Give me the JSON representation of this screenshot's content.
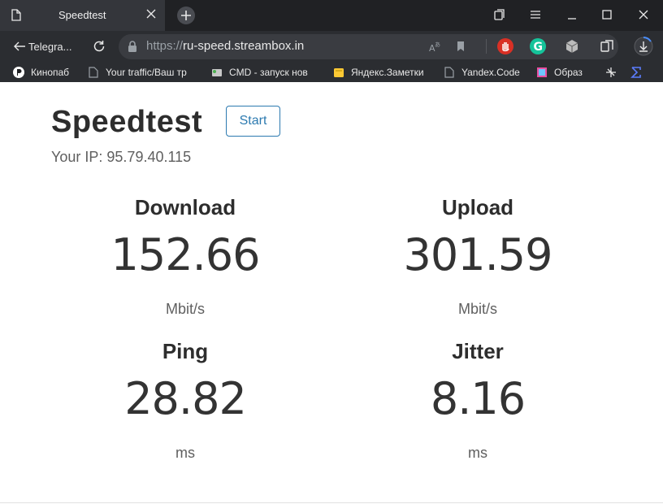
{
  "browser": {
    "tab_title": "Speedtest",
    "back_label": "Telegra...",
    "url_protocol": "https://",
    "url_host": "ru-speed.streambox.in",
    "bookmarks": [
      {
        "label": "Кинопаб",
        "icon": "kinopub-icon"
      },
      {
        "label": "Your traffic/Ваш тр",
        "icon": "document-icon"
      },
      {
        "label": "CMD - запуск нов",
        "icon": "cmd-icon"
      },
      {
        "label": "Яндекс.Заметки",
        "icon": "yandex-notes-icon"
      },
      {
        "label": "Yandex.Code",
        "icon": "document-icon"
      },
      {
        "label": "Образ",
        "icon": "image-icon"
      }
    ]
  },
  "page": {
    "title": "Speedtest",
    "start_label": "Start",
    "ip_label": "Your IP:",
    "ip_value": "95.79.40.115",
    "metrics": {
      "download": {
        "label": "Download",
        "value": "152.66",
        "unit": "Mbit/s"
      },
      "upload": {
        "label": "Upload",
        "value": "301.59",
        "unit": "Mbit/s"
      },
      "ping": {
        "label": "Ping",
        "value": "28.82",
        "unit": "ms"
      },
      "jitter": {
        "label": "Jitter",
        "value": "8.16",
        "unit": "ms"
      }
    }
  },
  "colors": {
    "accent": "#2c7ab0",
    "chrome_bg": "#2b2d31",
    "tab_strip": "#202124"
  }
}
